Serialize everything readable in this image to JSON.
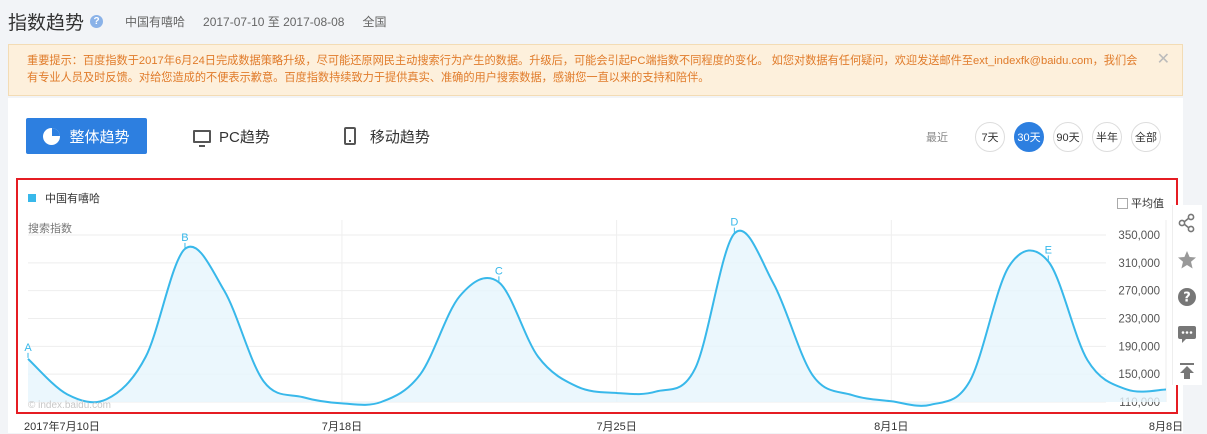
{
  "header": {
    "title": "指数趋势",
    "keyword": "中国有嘻哈",
    "date_range": "2017-07-10 至 2017-08-08",
    "region": "全国"
  },
  "notice": {
    "text": "重要提示：百度指数于2017年6月24日完成数据策略升级，尽可能还原网民主动搜索行为产生的数据。升级后，可能会引起PC端指数不同程度的变化。 如您对数据有任何疑问，欢迎发送邮件至ext_indexfk@baidu.com，我们会有专业人员及时反馈。对给您造成的不便表示歉意。百度指数持续致力于提供真实、准确的用户搜索数据，感谢您一直以来的支持和陪伴。",
    "close": "✕"
  },
  "tabs": {
    "overall": "整体趋势",
    "pc": "PC趋势",
    "mobile": "移动趋势"
  },
  "range": {
    "label": "最近",
    "options": [
      "7天",
      "30天",
      "90天",
      "半年",
      "全部"
    ],
    "selected": "30天"
  },
  "chart_data": {
    "type": "area",
    "series": [
      {
        "name": "中国有嘻哈",
        "color": "#38b8ea",
        "values": [
          172000,
          121000,
          114000,
          175000,
          330000,
          270000,
          140000,
          117000,
          108000,
          110000,
          150000,
          262000,
          282000,
          175000,
          132000,
          123000,
          125000,
          158000,
          352000,
          280000,
          148000,
          120000,
          111000,
          106000,
          140000,
          305000,
          312000,
          170000,
          128000,
          128000
        ]
      }
    ],
    "x_start": "2017-07-10",
    "x_end": "2017-08-08",
    "xticks": [
      "2017年7月10日",
      "7月18日",
      "7月25日",
      "8月1日",
      "8月8日"
    ],
    "yticks": [
      "350,000",
      "310,000",
      "270,000",
      "230,000",
      "190,000",
      "150,000",
      "110,000"
    ],
    "ylabel": "搜索指数",
    "ylim": [
      110000,
      350000
    ],
    "annotations": [
      {
        "label": "A",
        "index": 0
      },
      {
        "label": "B",
        "index": 4
      },
      {
        "label": "C",
        "index": 12
      },
      {
        "label": "D",
        "index": 18
      },
      {
        "label": "E",
        "index": 26
      }
    ],
    "grid": true,
    "legend": "top-left"
  },
  "avg_label": "平均值",
  "watermark": "© index.baidu.com"
}
